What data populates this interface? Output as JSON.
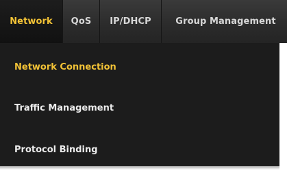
{
  "menubar": {
    "tabs": [
      {
        "label": "Network",
        "active": true
      },
      {
        "label": "QoS",
        "active": false
      },
      {
        "label": "IP/DHCP",
        "active": false
      },
      {
        "label": "Group Management",
        "active": false
      }
    ]
  },
  "dropdown": {
    "items": [
      {
        "label": "Network Connection",
        "selected": true
      },
      {
        "label": "Traffic Management",
        "selected": false
      },
      {
        "label": "Protocol Binding",
        "selected": false
      }
    ]
  },
  "colors": {
    "accent": "#f2c236",
    "menubar_bg": "#2c2c2c",
    "dropdown_bg": "#1c1c1c",
    "text": "#ececec"
  }
}
